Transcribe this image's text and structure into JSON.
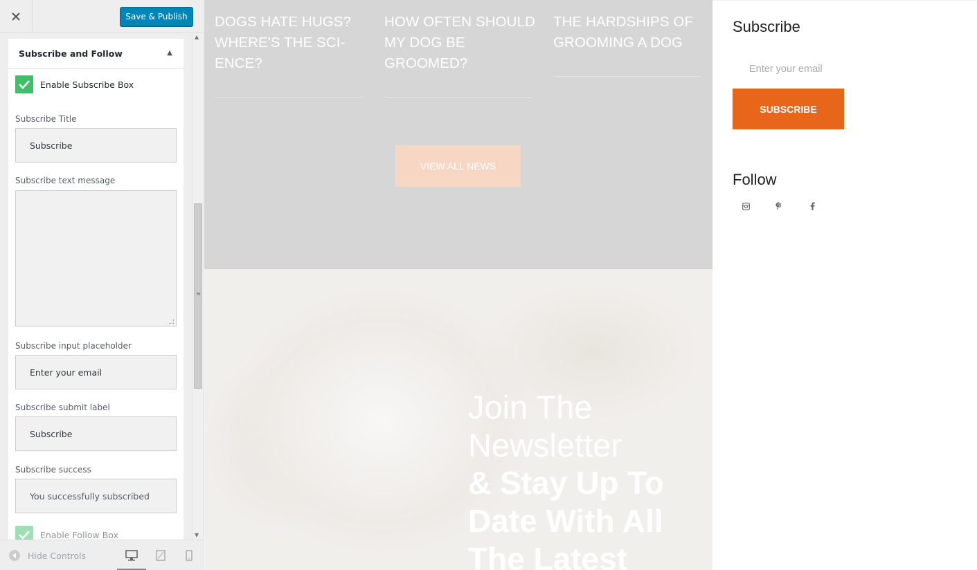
{
  "customizer": {
    "header": {
      "close_icon": "close-icon",
      "save_label": "Save & Publish"
    },
    "section": {
      "title": "Subscribe and Follow",
      "collapse_icon": "triangle-up-icon"
    },
    "enable_subscribe": {
      "label": "Enable Subscribe Box",
      "checked": true
    },
    "fields": {
      "title_label": "Subscribe Title",
      "title_value": "Subscribe",
      "text_label": "Subscribe text message",
      "text_value": "",
      "placeholder_label": "Subscribe input placeholder",
      "placeholder_value": "Enter your email",
      "submit_label": "Subscribe submit label",
      "submit_value": "Subscribe",
      "success_label": "Subscribe success",
      "success_value": "You successfully subscribed"
    },
    "enable_follow": {
      "label": "Enable Follow Box",
      "checked": true
    },
    "footer": {
      "hide_label": "Hide Controls",
      "devices": [
        "desktop-icon",
        "tablet-icon",
        "mobile-icon"
      ],
      "active_device": "desktop"
    }
  },
  "preview": {
    "news": [
      "DOGS HATE HUGS? WHERE'S THE SCI-ENCE?",
      "HOW OFTEN SHOULD MY DOG BE GROOMED?",
      "THE HARDSHIPS OF GROOMING A DOG"
    ],
    "view_all_label": "VIEW ALL NEWS",
    "newsletter_light": "Join The Newsletter",
    "newsletter_bold": "& Stay Up To Date With All The Latest"
  },
  "widgets": {
    "subscribe_title": "Subscribe",
    "email_placeholder": "Enter your email",
    "subscribe_button": "SUBSCRIBE",
    "follow_title": "Follow",
    "social_icons": [
      "instagram-icon",
      "pinterest-icon",
      "facebook-icon"
    ]
  },
  "colors": {
    "save_button": "#0085ba",
    "checkbox": "#3fbf6a",
    "subscribe_button": "#e8661a",
    "view_all_button": "#f7d6c4"
  }
}
